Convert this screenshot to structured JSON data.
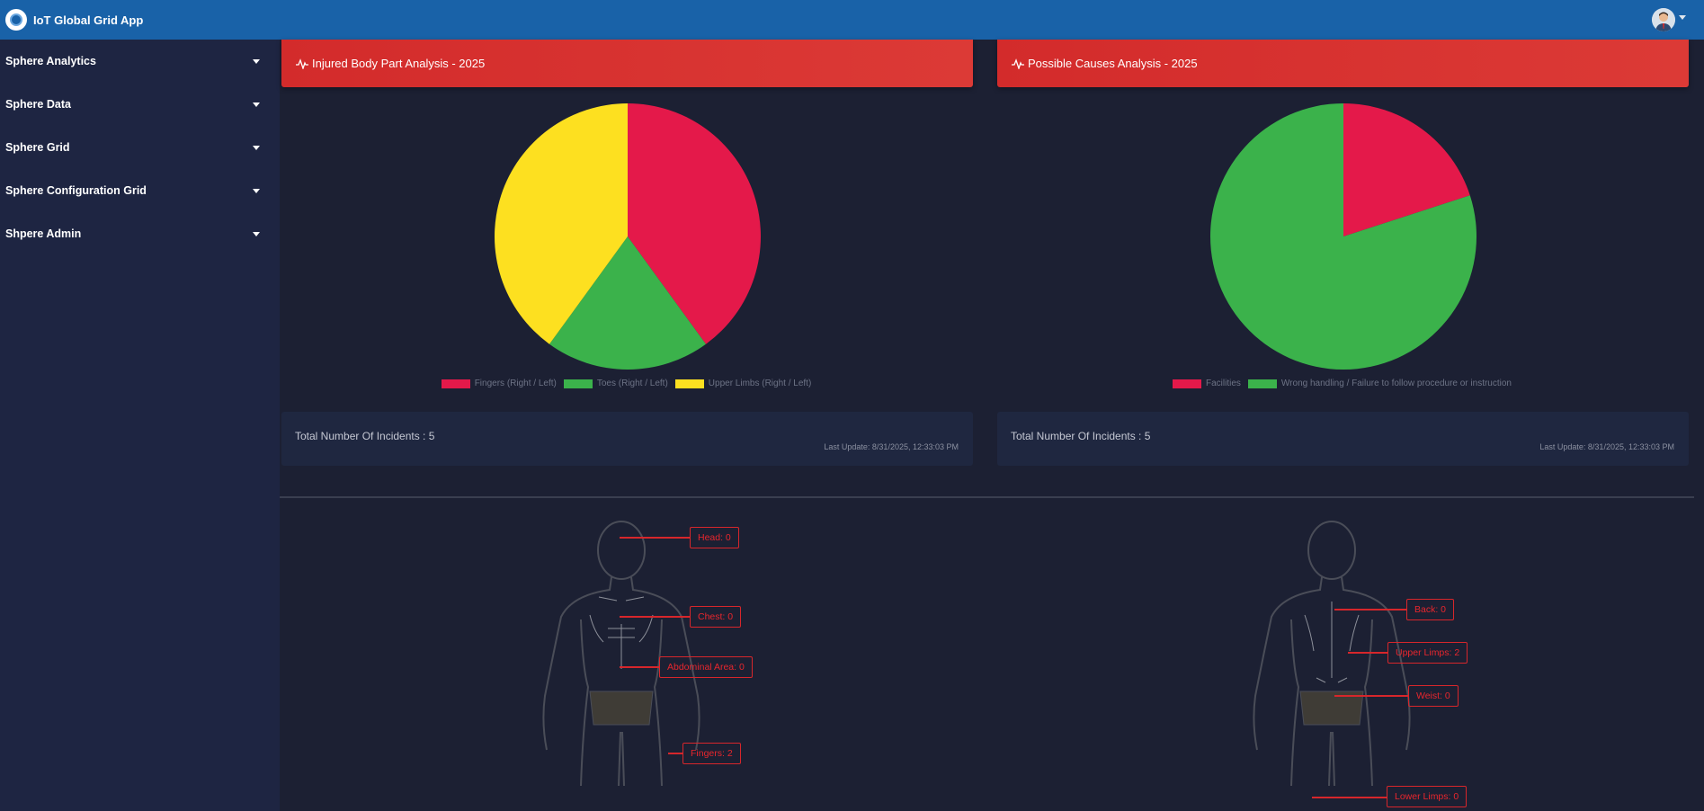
{
  "app": {
    "title": "IoT Global Grid App"
  },
  "header": {
    "logo_icon": "globe-logo-icon",
    "avatar_icon": "user-avatar-icon"
  },
  "sidebar": {
    "items": [
      {
        "label": "Sphere Analytics"
      },
      {
        "label": "Sphere Data"
      },
      {
        "label": "Sphere Grid"
      },
      {
        "label": "Sphere Configuration Grid"
      },
      {
        "label": "Shpere Admin"
      }
    ]
  },
  "colors": {
    "topbar": "#1962a8",
    "header_red": "#d32b2b",
    "crimson": "#e4194a",
    "green": "#3bb24b",
    "yellow": "#fde020"
  },
  "cards": [
    {
      "title": "Injured Body Part Analysis - 2025",
      "icon": "pulse-icon",
      "total": "Total Number Of Incidents : 5",
      "last_update": "Last Update: 8/31/2025, 12:33:03 PM"
    },
    {
      "title": "Possible Causes Analysis - 2025",
      "icon": "pulse-icon",
      "total": "Total Number Of Incidents : 5",
      "last_update": "Last Update: 8/31/2025, 12:33:03 PM"
    }
  ],
  "chart_data": [
    {
      "type": "pie",
      "title": "Injured Body Part Analysis - 2025",
      "categories": [
        "Fingers (Right / Left)",
        "Toes (Right / Left)",
        "Upper Limbs (Right / Left)"
      ],
      "values": [
        2,
        1,
        2
      ],
      "colors": [
        "#e4194a",
        "#3bb24b",
        "#fde020"
      ],
      "legend": "bottom"
    },
    {
      "type": "pie",
      "title": "Possible Causes Analysis - 2025",
      "categories": [
        "Facilities",
        "Wrong handling / Failure to follow procedure or instruction"
      ],
      "values": [
        1,
        4
      ],
      "colors": [
        "#e4194a",
        "#3bb24b"
      ],
      "legend": "bottom"
    }
  ],
  "body_map": {
    "front": [
      {
        "label": "Head: 0"
      },
      {
        "label": "Chest: 0"
      },
      {
        "label": "Abdominal Area: 0"
      },
      {
        "label": "Fingers: 2"
      }
    ],
    "back": [
      {
        "label": "Back: 0"
      },
      {
        "label": "Upper Limps: 2"
      },
      {
        "label": "Weist: 0"
      },
      {
        "label": "Lower Limps: 0"
      }
    ]
  }
}
